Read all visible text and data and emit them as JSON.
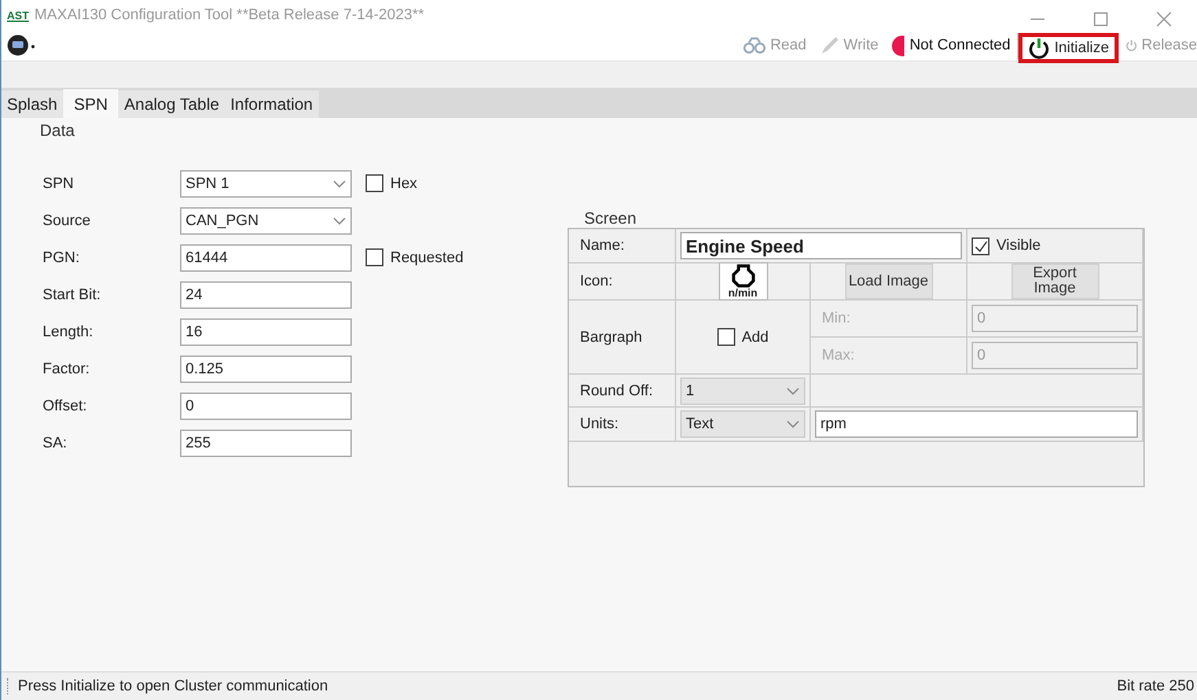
{
  "window": {
    "title": "MAXAI130 Configuration Tool **Beta Release 7-14-2023**",
    "logo": "AST"
  },
  "toolbar": {
    "items": [
      {
        "kind": "read",
        "label": "Read",
        "disabled": true
      },
      {
        "kind": "write",
        "label": "Write",
        "disabled": true
      },
      {
        "kind": "status",
        "label": "Not Connected",
        "color": "#e8174f"
      },
      {
        "kind": "initialize",
        "label": "Initialize",
        "disabled": false,
        "highlighted": true
      },
      {
        "kind": "release",
        "label": "Release",
        "disabled": true
      }
    ]
  },
  "tabs": [
    {
      "label": "Splash",
      "selected": false
    },
    {
      "label": "SPN",
      "selected": true
    },
    {
      "label": "Analog Table",
      "selected": false
    },
    {
      "label": "Information",
      "selected": false
    }
  ],
  "data": {
    "title": "Data",
    "fields": [
      {
        "label": "SPN",
        "kind": "combo",
        "value": "SPN 1",
        "checkbox": {
          "label": "Hex",
          "checked": false
        }
      },
      {
        "label": "Source",
        "kind": "combo",
        "value": "CAN_PGN"
      },
      {
        "label": "PGN:",
        "kind": "text",
        "value": "61444",
        "checkbox": {
          "label": "Requested",
          "checked": false
        }
      },
      {
        "label": "Start Bit:",
        "kind": "text",
        "value": "24"
      },
      {
        "label": "Length:",
        "kind": "text",
        "value": "16"
      },
      {
        "label": "Factor:",
        "kind": "text",
        "value": "0.125"
      },
      {
        "label": "Offset:",
        "kind": "text",
        "value": "0"
      },
      {
        "label": "SA:",
        "kind": "text",
        "value": "255"
      }
    ]
  },
  "screen": {
    "title": "Screen",
    "name": {
      "label": "Name:",
      "value": "Engine Speed"
    },
    "visible": {
      "label": "Visible",
      "checked": true
    },
    "icon": {
      "label": "Icon:",
      "caption": "n/min"
    },
    "buttons": [
      "Load Image",
      "Export Image"
    ],
    "bargraph": {
      "label": "Bargraph",
      "add": {
        "label": "Add",
        "checked": false
      },
      "min": {
        "label": "Min:",
        "value": "0",
        "disabled": true
      },
      "max": {
        "label": "Max:",
        "value": "0",
        "disabled": true
      }
    },
    "round_off": {
      "label": "Round Off:",
      "value": "1"
    },
    "units": {
      "label": "Units:",
      "type": "Text",
      "value": "rpm"
    }
  },
  "status_bar": {
    "message": "Press Initialize to open Cluster communication",
    "right": "Bit rate 250"
  }
}
